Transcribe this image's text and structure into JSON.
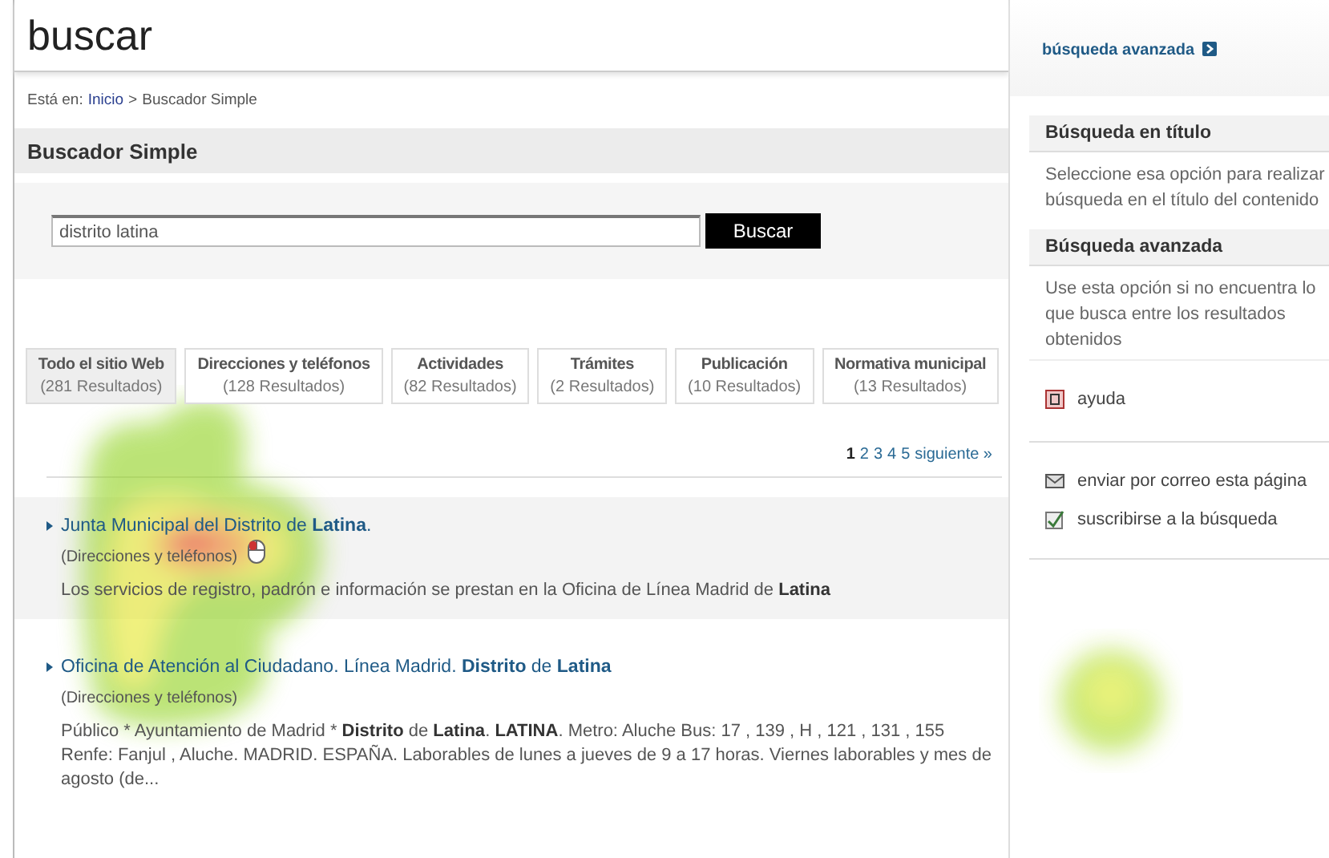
{
  "header": {
    "title": "buscar"
  },
  "breadcrumb": {
    "prefix": "Está en:",
    "items": [
      {
        "label": "Inicio",
        "kind": "link"
      },
      {
        "label": "Buscador Simple",
        "kind": "current"
      }
    ],
    "separator": ">"
  },
  "section_title": "Buscador Simple",
  "search": {
    "value": "distrito latina",
    "button": "Buscar"
  },
  "tabs": [
    {
      "label": "Todo el sitio Web",
      "count": "(281 Resultados)",
      "selected": true
    },
    {
      "label": "Direcciones y teléfonos",
      "count": "(128 Resultados)",
      "selected": false
    },
    {
      "label": "Actividades",
      "count": "(82 Resultados)",
      "selected": false
    },
    {
      "label": "Trámites",
      "count": "(2 Resultados)",
      "selected": false
    },
    {
      "label": "Publicación",
      "count": "(10 Resultados)",
      "selected": false
    },
    {
      "label": "Normativa municipal",
      "count": "(13 Resultados)",
      "selected": false
    }
  ],
  "pagination": {
    "pages": [
      {
        "label": "1",
        "selected": true
      },
      {
        "label": "2",
        "selected": false
      },
      {
        "label": "3",
        "selected": false
      },
      {
        "label": "4",
        "selected": false
      },
      {
        "label": "5",
        "selected": false
      }
    ],
    "next": "siguiente »"
  },
  "results": [
    {
      "title": "Junta Municipal del Distrito de **Latina**.",
      "category": "(Direcciones y teléfonos)",
      "snippet": "Los servicios de registro, padrón e información se prestan en la Oficina de Línea Madrid de **Latina**",
      "highlighted": true
    },
    {
      "title": "Oficina de Atención al Ciudadano. Línea Madrid. **Distrito** de **Latina**",
      "category": "(Direcciones y teléfonos)",
      "snippet": "Público * Ayuntamiento de Madrid * **Distrito** de **Latina**. **LATINA**. Metro: Aluche Bus: 17 , 139 , H , 121 , 131 , 155 Renfe: Fanjul , Aluche. MADRID. ESPAÑA. Laborables de lunes a jueves de 9 a 17 horas. Viernes laborables y mes de agosto (de...",
      "highlighted": false
    }
  ],
  "sidebar": {
    "advanced_link": "búsqueda avanzada",
    "panels": [
      {
        "title": "Búsqueda en título",
        "lines": [
          "Seleccione esa opción para realizar",
          "búsqueda en el título del contenido"
        ]
      },
      {
        "title": "Búsqueda avanzada",
        "lines": [
          "Use esta opción si no encuentra lo",
          "que busca entre los resultados",
          "obtenidos"
        ]
      }
    ],
    "help": "ayuda",
    "actions": [
      {
        "label": "enviar por correo esta página",
        "kind": "email"
      },
      {
        "label": "suscribirse a la búsqueda",
        "kind": "subscribe"
      }
    ]
  }
}
